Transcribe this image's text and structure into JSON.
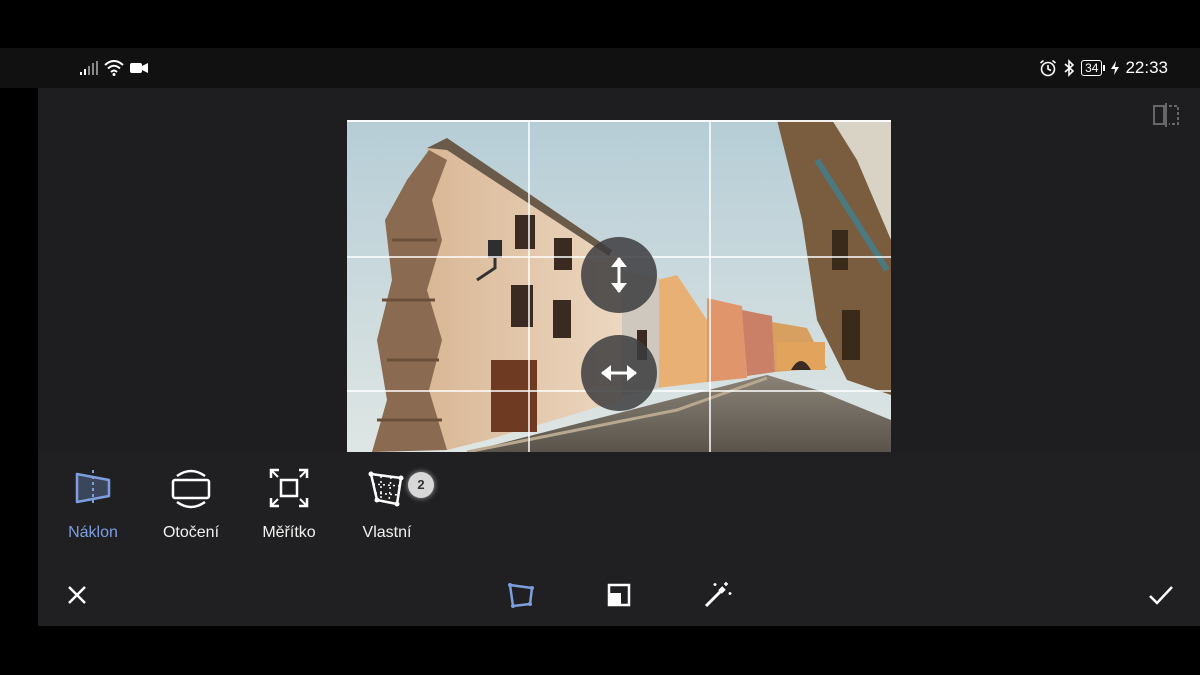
{
  "status_bar": {
    "time": "22:33",
    "battery": "34",
    "left_icons": [
      "signal-icon",
      "wifi-icon",
      "video-camera-icon"
    ],
    "right_icons": [
      "alarm-icon",
      "bluetooth-icon",
      "battery-icon",
      "charging-icon"
    ]
  },
  "editor": {
    "compare_icon": "compare-icon",
    "handles": [
      {
        "name": "vertical-perspective-handle",
        "icon": "arrow-up-down-icon"
      },
      {
        "name": "horizontal-perspective-handle",
        "icon": "arrow-left-right-icon"
      }
    ]
  },
  "tools": [
    {
      "label": "Náklon",
      "icon": "tilt-icon",
      "active": true
    },
    {
      "label": "Otočení",
      "icon": "rotate-icon",
      "active": false
    },
    {
      "label": "Měřítko",
      "icon": "scale-icon",
      "active": false
    },
    {
      "label": "Vlastní",
      "icon": "custom-perspective-icon",
      "active": false,
      "badge": "2"
    }
  ],
  "bottom_bar": {
    "cancel_icon": "close-icon",
    "perspective_icon": "perspective-icon",
    "crop_icon": "crop-square-icon",
    "auto_icon": "magic-wand-icon",
    "confirm_icon": "check-icon"
  },
  "colors": {
    "accent": "#7d9fe0",
    "panel": "#202022",
    "editor_bg": "#1e1e20"
  }
}
